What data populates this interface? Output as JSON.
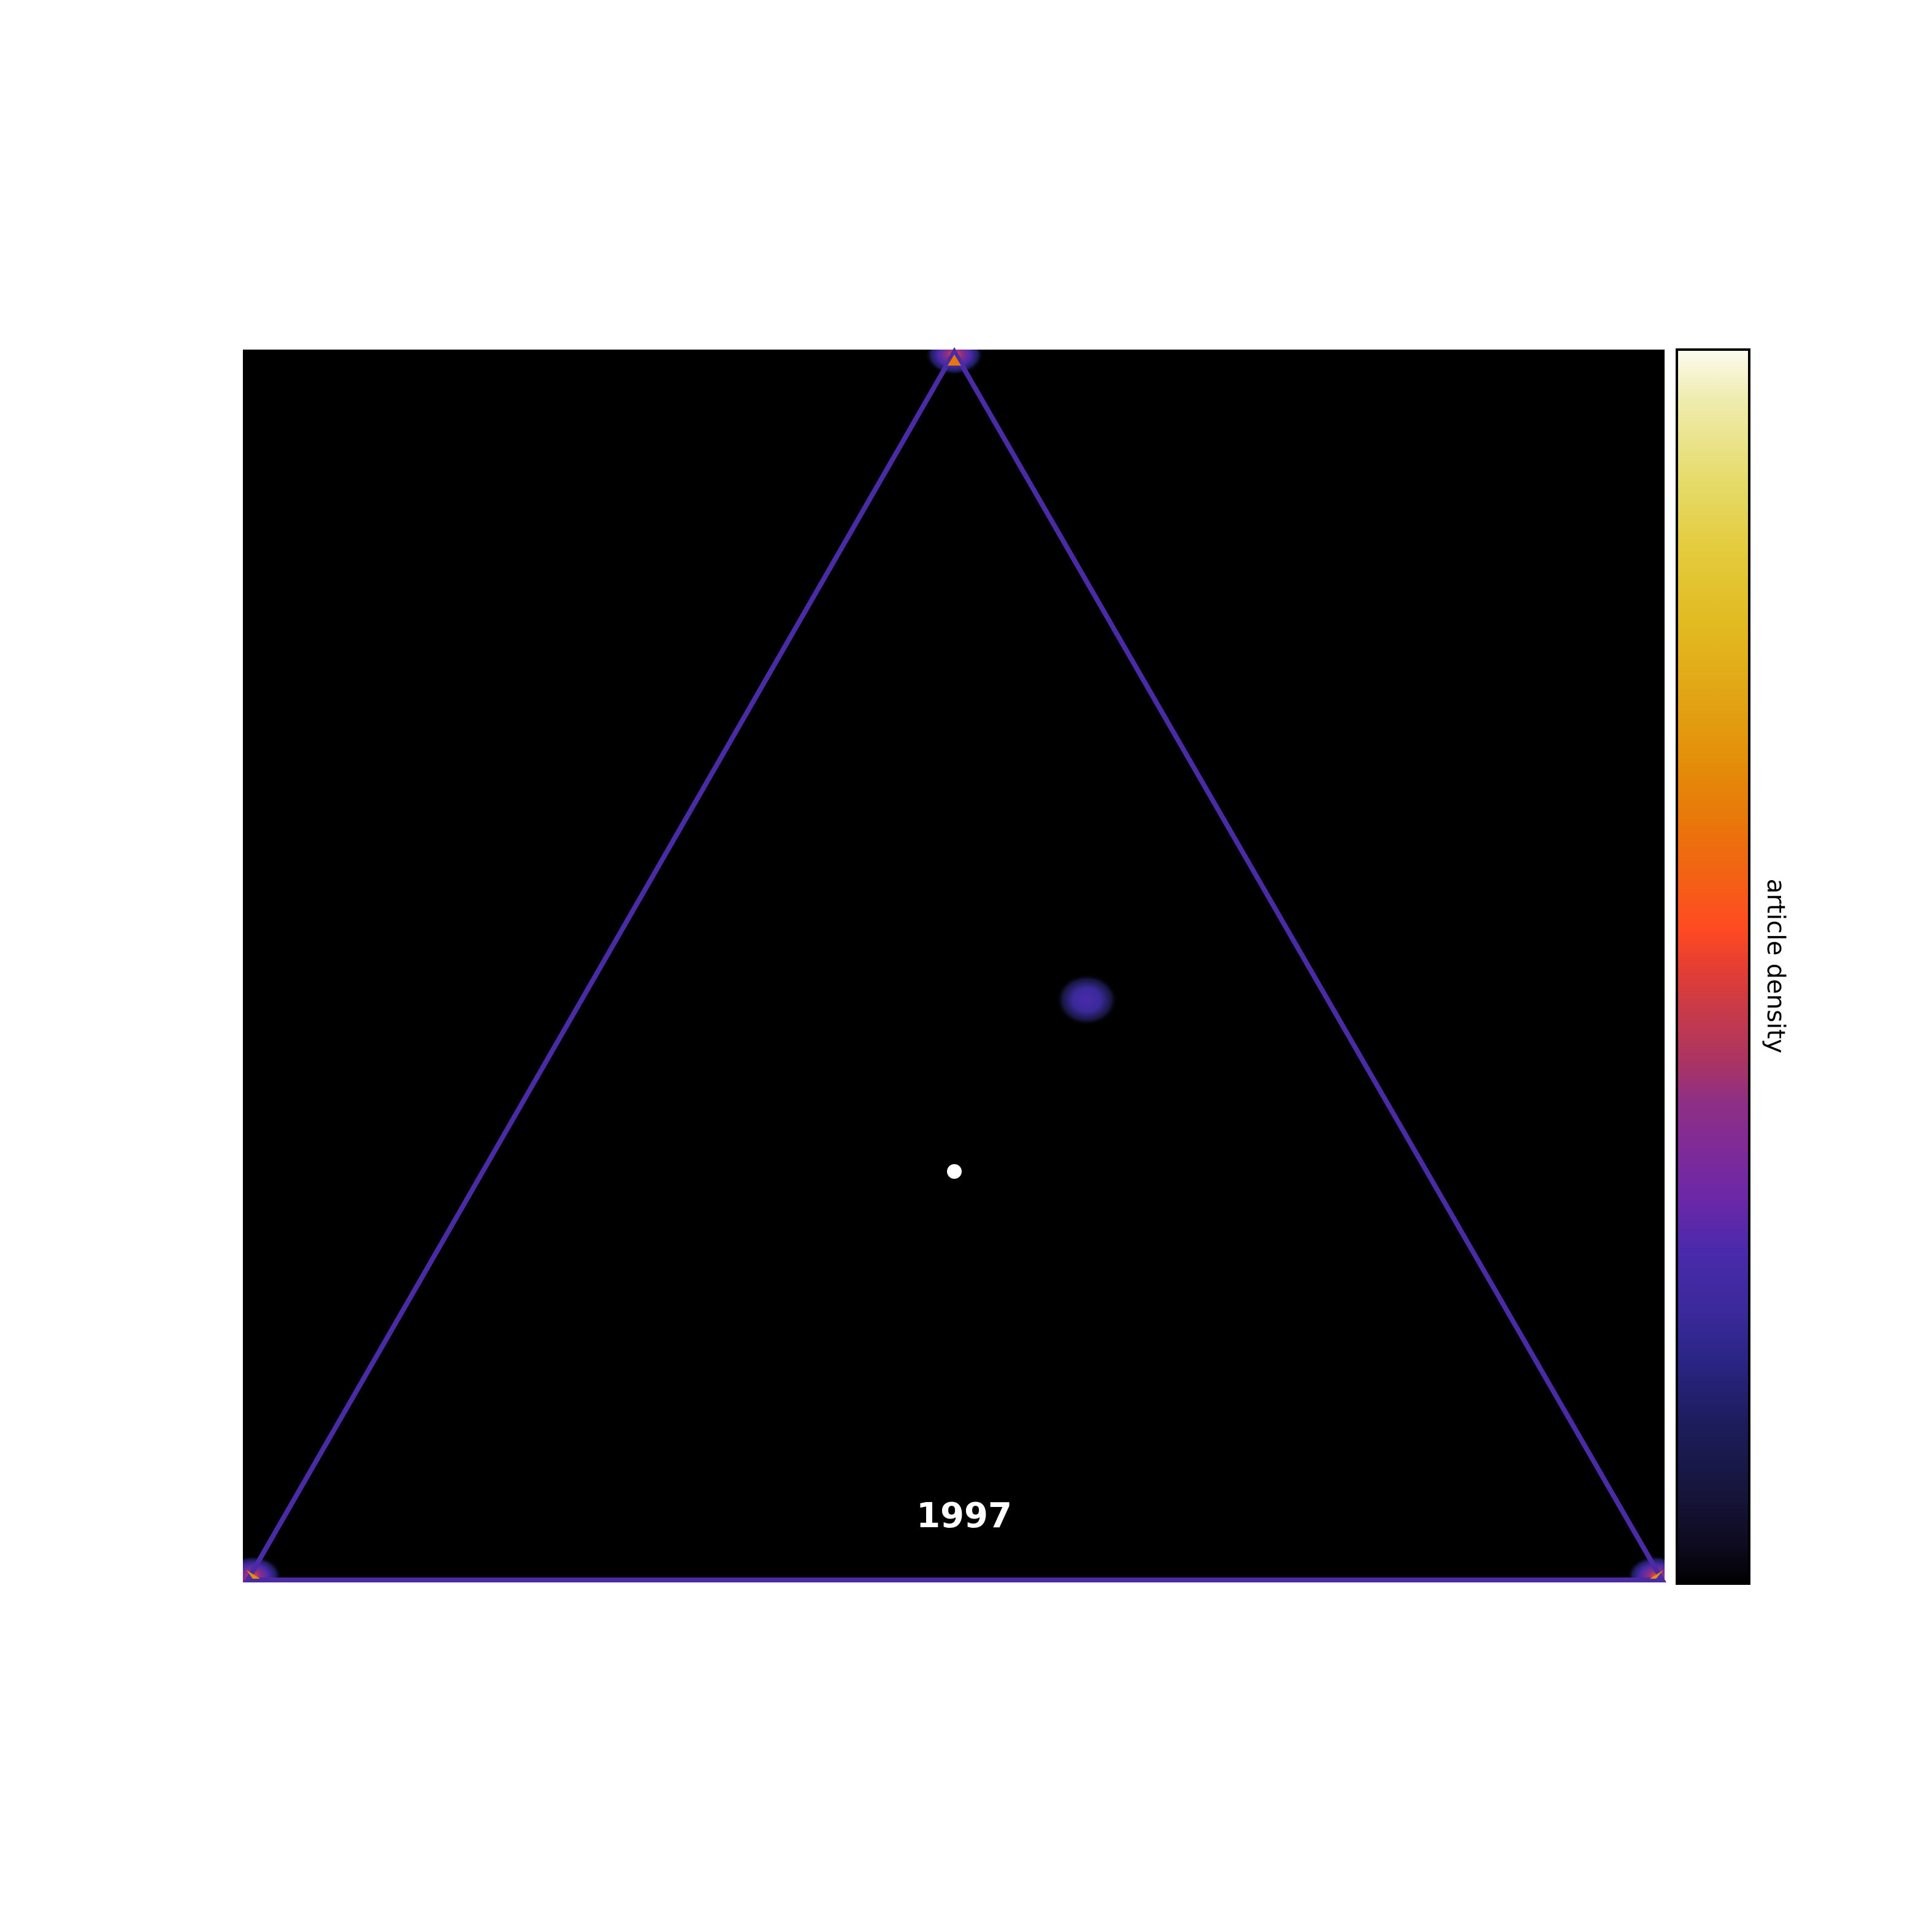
{
  "chart_data": {
    "type": "heatmap",
    "subtype": "ternary-density",
    "year_label": "1997",
    "colorbar_label": "article density",
    "colormap": [
      "#000000",
      "#0e0a1f",
      "#17163f",
      "#1d1d5c",
      "#2a2585",
      "#3a2a9a",
      "#4a2aaa",
      "#6a28a8",
      "#7e2a98",
      "#8e2f85",
      "#a83465",
      "#c43a4c",
      "#e53e32",
      "#ff4a22",
      "#f46015",
      "#e8780a",
      "#e3900a",
      "#e2a514",
      "#e2bb22",
      "#e3cc3e",
      "#e6dd70",
      "#efecb0",
      "#fcfbef"
    ],
    "vertex_labels": [
      "",
      "",
      ""
    ],
    "density_peaks": [
      {
        "vertex": "top",
        "level": "high"
      },
      {
        "vertex": "bottom-left",
        "level": "high"
      },
      {
        "vertex": "bottom-right",
        "level": "high"
      },
      {
        "vertex": "interior",
        "level": "low"
      }
    ],
    "grid": false,
    "legend": "colorbar-right"
  },
  "colors": {
    "background": "#000000",
    "edge": "#4b2aa6",
    "marker": "#ffffff",
    "year_text": "#ffffff"
  }
}
